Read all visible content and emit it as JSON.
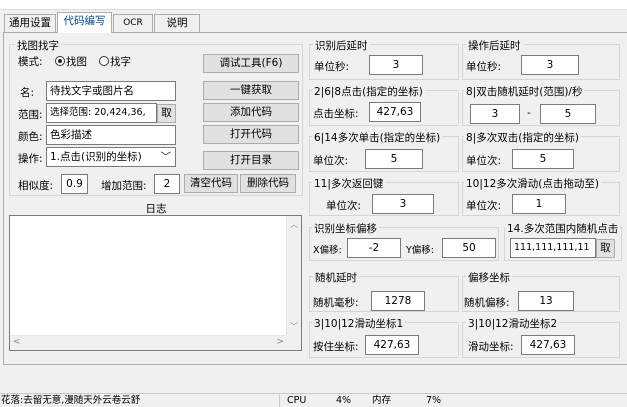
{
  "tabs": [
    {
      "label": "通用设置",
      "active": false
    },
    {
      "label": "代码编写",
      "active": true
    },
    {
      "label": "OCR",
      "active": false
    },
    {
      "label": "说明",
      "active": false
    }
  ],
  "find": {
    "group_label": "找图找字",
    "mode_label": "模式:",
    "mode_image": "找图",
    "mode_text": "找字",
    "name_label": "名:",
    "name_value": "待找文字或图片名",
    "range_label": "范围:",
    "range_value": "选择范围: 20,424,36,",
    "range_button": "取",
    "color_label": "颜色:",
    "color_value": "色彩描述",
    "op_label": "操作:",
    "op_value": "1.点击(识别的坐标)",
    "similarity_label": "相似度:",
    "similarity_value": "0.9",
    "expand_label": "增加范围:",
    "expand_value": "2",
    "btn_debug": "调试工具(F6)",
    "btn_onekey": "一键获取",
    "btn_add": "添加代码",
    "btn_open_code": "打开代码",
    "btn_open_dir": "打开目录",
    "btn_clear": "清空代码",
    "btn_delete": "删除代码"
  },
  "log": {
    "label": "日志"
  },
  "right": {
    "recog_delay": {
      "label": "识别后延时",
      "unit": "单位秒:",
      "value": "3"
    },
    "op_delay": {
      "label": "操作后延时",
      "unit": "单位秒:",
      "value": "3"
    },
    "click_coord": {
      "label": "2|6|8点击(指定的坐标)",
      "unit": "点击坐标:",
      "value": "427,63"
    },
    "dbl_random": {
      "label": "8|双击随机延时(范围)/秒",
      "min": "3",
      "sep": "-",
      "max": "5"
    },
    "multi_click": {
      "label": "6|14多次单击(指定的坐标)",
      "unit": "单位次:",
      "value": "5"
    },
    "multi_dbl": {
      "label": "8|多次双击(指定的坐标)",
      "unit": "单位次:",
      "value": "5"
    },
    "back_key": {
      "label": "11|多次返回键",
      "unit": "单位次:",
      "value": "3"
    },
    "multi_drag": {
      "label": "10|12多次滑动(点击拖动至)",
      "unit": "单位次:",
      "value": "1"
    },
    "offset": {
      "label": "识别坐标偏移",
      "x_label": "X偏移:",
      "x_value": "-2",
      "y_label": "Y偏移:",
      "y_value": "50"
    },
    "range_random": {
      "label": "14.多次范围内随机点击",
      "value": "111,111,111,11",
      "button": "取"
    },
    "random_delay": {
      "label": "随机延时",
      "unit": "随机毫秒:",
      "value": "1278"
    },
    "offset_coord": {
      "label": "偏移坐标",
      "unit": "随机偏移:",
      "value": "13"
    },
    "slide1": {
      "label": "3|10|12滑动坐标1",
      "unit": "按住坐标:",
      "value": "427,63"
    },
    "slide2": {
      "label": "3|10|12滑动坐标2",
      "unit": "滑动坐标:",
      "value": "427,63"
    }
  },
  "status": {
    "marquee": "花落:去留无意,漫随天外云卷云舒",
    "cpu_label": "CPU",
    "cpu_value": "4%",
    "mem_label": "内存",
    "mem_value": "7%"
  }
}
